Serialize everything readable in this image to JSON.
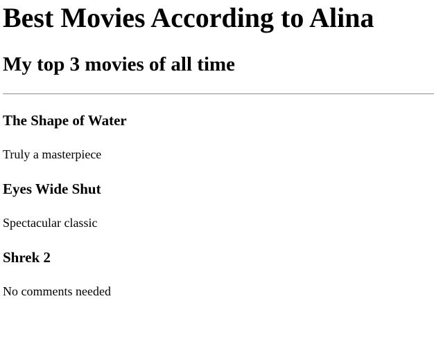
{
  "page": {
    "title": "Best Movies According to Alina",
    "subtitle": "My top 3 movies of all time"
  },
  "movies": [
    {
      "title": "The Shape of Water",
      "comment": "Truly a masterpiece"
    },
    {
      "title": "Eyes Wide Shut",
      "comment": "Spectacular classic"
    },
    {
      "title": "Shrek 2",
      "comment": "No comments needed"
    }
  ]
}
